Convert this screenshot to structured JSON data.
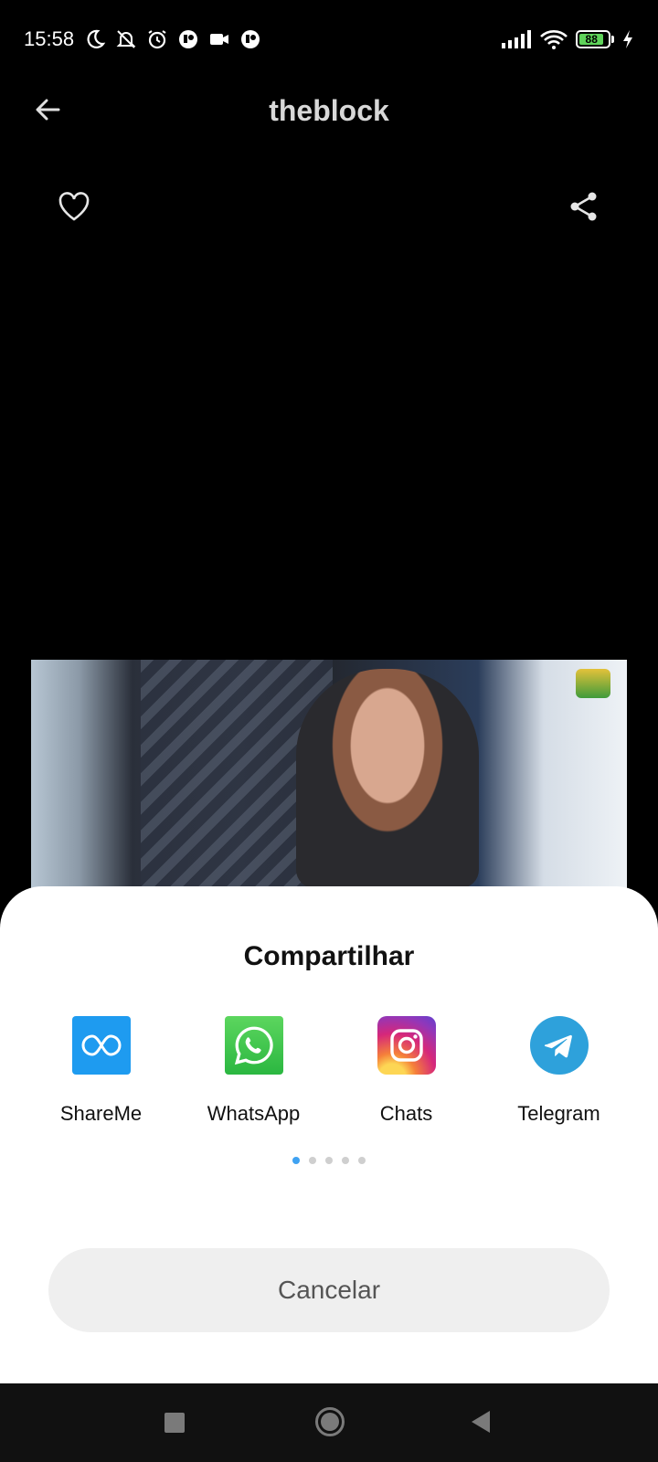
{
  "status_bar": {
    "time": "15:58",
    "battery_level": "88",
    "left_icons": [
      "moon-icon",
      "muted-bell-icon",
      "alarm-icon",
      "app-notification-icon",
      "video-camera-icon",
      "app-notification-icon"
    ],
    "right_icons": [
      "signal-icon",
      "wifi-icon",
      "battery-icon",
      "charging-icon"
    ]
  },
  "header": {
    "title": "theblock",
    "back_icon": "arrow-left-icon",
    "favorite_icon": "heart-icon",
    "share_icon": "share-icon"
  },
  "share_sheet": {
    "title": "Compartilhar",
    "apps": [
      {
        "label": "ShareMe",
        "icon": "shareme-icon",
        "color": "#1e9bf0"
      },
      {
        "label": "WhatsApp",
        "icon": "whatsapp-icon",
        "color": "#2bb741"
      },
      {
        "label": "Chats",
        "icon": "instagram-icon",
        "color": "#d6277a"
      },
      {
        "label": "Telegram",
        "icon": "telegram-icon",
        "color": "#2ea1db"
      }
    ],
    "page_count": 5,
    "current_page": 1,
    "cancel_label": "Cancelar"
  },
  "nav_bar": {
    "items": [
      "recents-icon",
      "home-icon",
      "back-icon"
    ]
  },
  "colors": {
    "accent": "#3fa2f2",
    "battery": "#5fd35a"
  }
}
